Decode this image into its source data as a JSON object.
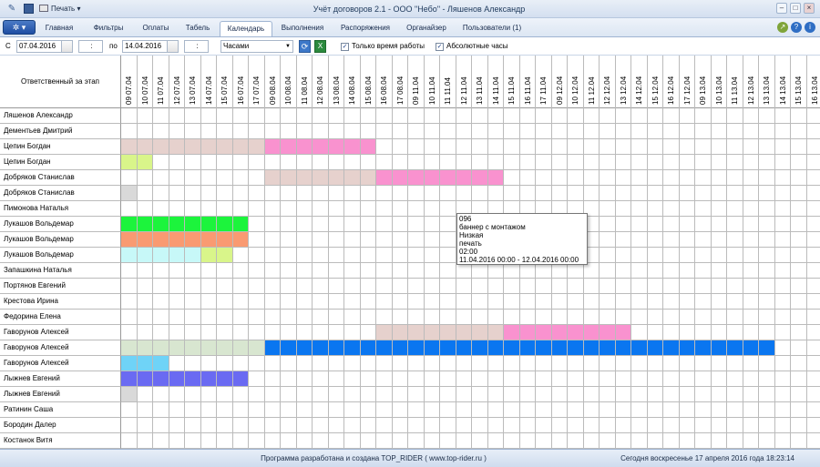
{
  "app": {
    "title": "Учёт договоров 2.1 - ООО \"Небо\" - Ляшенов Александр",
    "print_label": "Печать"
  },
  "tabs": [
    "Главная",
    "Фильтры",
    "Оплаты",
    "Табель",
    "Календарь",
    "Выполнения",
    "Распоряжения",
    "Органайзер",
    "Пользователи (1)"
  ],
  "active_tab": 4,
  "toolbar": {
    "from_label": "С",
    "from_date": "07.04.2016",
    "from_time": ":",
    "to_label": "по",
    "to_date": "14.04.2016",
    "to_time": ":",
    "scale": "Часами",
    "only_work_time": "Только время работы",
    "absolute_hours": "Абсолютные часы"
  },
  "grid": {
    "responsible_header": "Ответственный за этап",
    "columns": [
      "09 07.04",
      "10 07.04",
      "11 07.04",
      "12 07.04",
      "13 07.04",
      "14 07.04",
      "15 07.04",
      "16 07.04",
      "17 07.04",
      "09 08.04",
      "10 08.04",
      "11 08.04",
      "12 08.04",
      "13 08.04",
      "14 08.04",
      "15 08.04",
      "16 08.04",
      "17 08.04",
      "09 11.04",
      "10 11.04",
      "11 11.04",
      "12 11.04",
      "13 11.04",
      "14 11.04",
      "15 11.04",
      "16 11.04",
      "17 11.04",
      "09 12.04",
      "10 12.04",
      "11 12.04",
      "12 12.04",
      "13 12.04",
      "14 12.04",
      "15 12.04",
      "16 12.04",
      "17 12.04",
      "09 13.04",
      "10 13.04",
      "11 13.04",
      "12 13.04",
      "13 13.04",
      "14 13.04",
      "15 13.04",
      "16 13.04",
      "17 13.04"
    ],
    "rows": [
      {
        "name": "Ляшенов Александр",
        "bars": []
      },
      {
        "name": "Дементьев Дмитрий",
        "bars": []
      },
      {
        "name": "Цепин Богдан",
        "bars": [
          {
            "start": 0,
            "end": 8,
            "color": "#e6d1cd"
          },
          {
            "start": 9,
            "end": 15,
            "color": "#f992cf"
          }
        ]
      },
      {
        "name": "Цепин Богдан",
        "bars": [
          {
            "start": 0,
            "end": 1,
            "color": "#d9f58a"
          }
        ]
      },
      {
        "name": "Добряков Станислав",
        "bars": [
          {
            "start": 9,
            "end": 15,
            "color": "#e6d1cd"
          },
          {
            "start": 16,
            "end": 23,
            "color": "#f992cf"
          }
        ]
      },
      {
        "name": "Добряков Станислав",
        "bars": [
          {
            "start": 0,
            "end": 0,
            "color": "#d9d9d9"
          }
        ]
      },
      {
        "name": "Пимонова Наталья",
        "bars": []
      },
      {
        "name": "Лукашов Вольдемар",
        "bars": [
          {
            "start": 0,
            "end": 7,
            "color": "#1cf43c"
          }
        ]
      },
      {
        "name": "Лукашов Вольдемар",
        "bars": [
          {
            "start": 0,
            "end": 7,
            "color": "#f99a72"
          }
        ]
      },
      {
        "name": "Лукашов Вольдемар",
        "bars": [
          {
            "start": 0,
            "end": 4,
            "color": "#c7f8f8"
          },
          {
            "start": 5,
            "end": 6,
            "color": "#d9f58a"
          }
        ]
      },
      {
        "name": "Запашкина Наталья",
        "bars": []
      },
      {
        "name": "Портянов Евгений",
        "bars": []
      },
      {
        "name": "Крестова Ирина",
        "bars": []
      },
      {
        "name": "Федорина Елена",
        "bars": []
      },
      {
        "name": "Гаворунов Алексей",
        "bars": [
          {
            "start": 16,
            "end": 23,
            "color": "#e6d1cd"
          },
          {
            "start": 24,
            "end": 31,
            "color": "#f992cf"
          }
        ]
      },
      {
        "name": "Гаворунов Алексей",
        "bars": [
          {
            "start": 0,
            "end": 8,
            "color": "#d8e6d0"
          },
          {
            "start": 9,
            "end": 40,
            "color": "#0a76f0"
          }
        ]
      },
      {
        "name": "Гаворунов Алексей",
        "bars": [
          {
            "start": 0,
            "end": 2,
            "color": "#6fd3f7"
          }
        ]
      },
      {
        "name": "Лыжнев Евгений",
        "bars": [
          {
            "start": 0,
            "end": 7,
            "color": "#6a6af2"
          }
        ]
      },
      {
        "name": "Лыжнев Евгений",
        "bars": [
          {
            "start": 0,
            "end": 0,
            "color": "#d9d9d9"
          }
        ]
      },
      {
        "name": "Ратинин Саша",
        "bars": []
      },
      {
        "name": "Бородин Далер",
        "bars": []
      },
      {
        "name": "Костанок Витя",
        "bars": []
      }
    ]
  },
  "tooltip": {
    "lines": [
      "096",
      "баннер с монтажом",
      "Низкая",
      "печать",
      "02:00",
      "11.04.2016  00:00 - 12.04.2016  00:00"
    ]
  },
  "status": {
    "credits": "Программа разработана и создана TOP_RIDER ( www.top-rider.ru )",
    "today": "Сегодня  воскресенье  17 апреля 2016 года  18:23:14"
  }
}
